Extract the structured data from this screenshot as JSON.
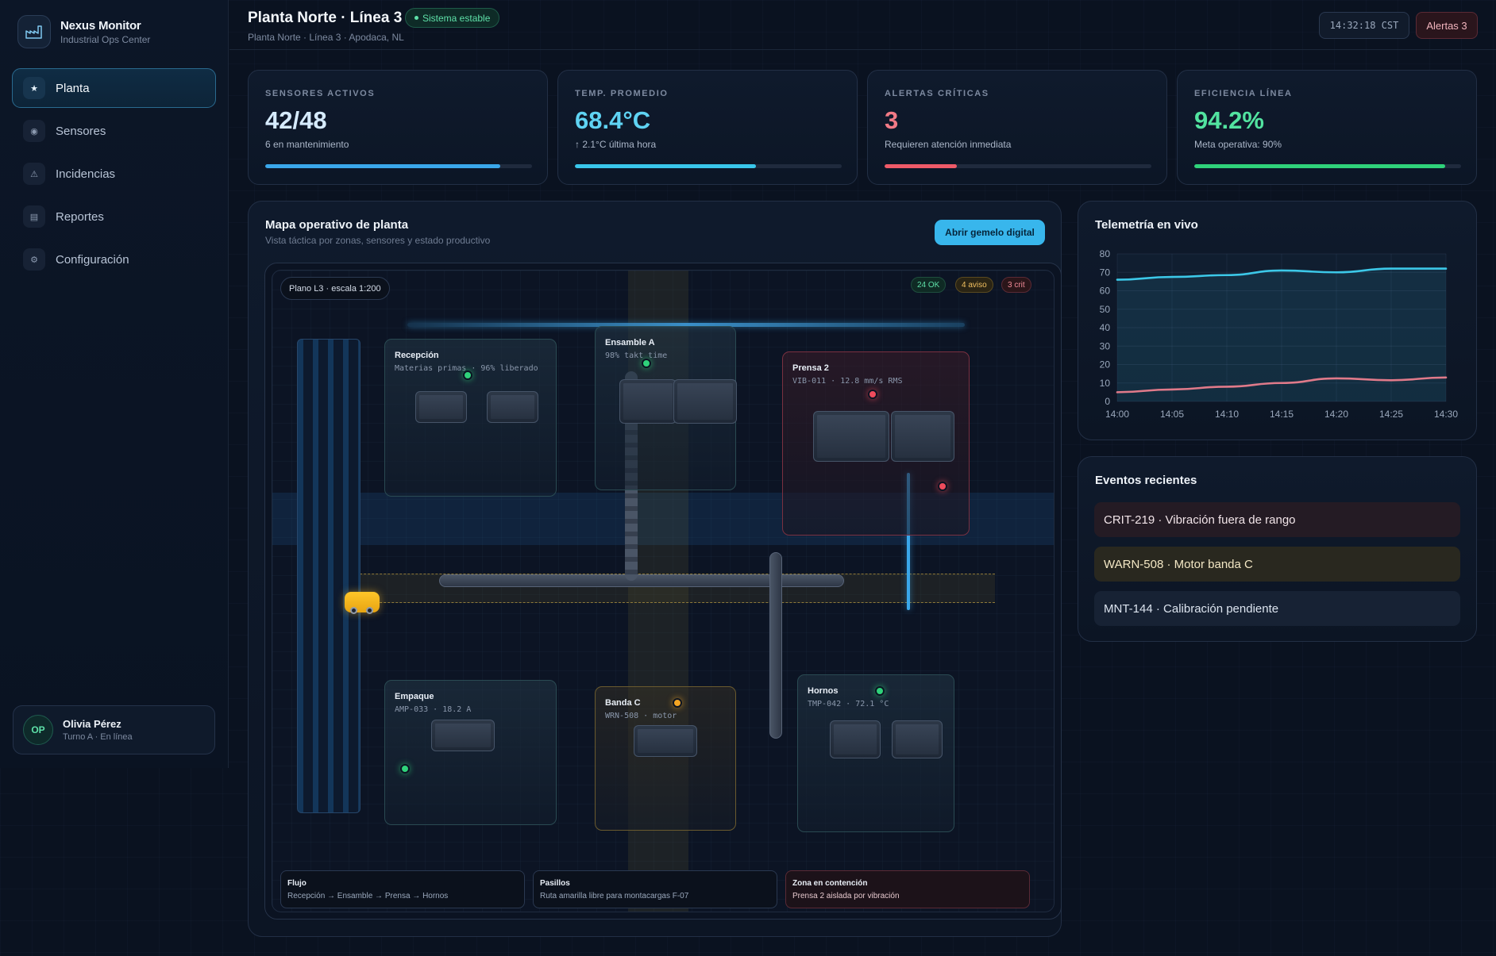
{
  "brand": {
    "name": "Nexus Monitor",
    "subtitle": "Industrial Ops Center"
  },
  "nav": [
    {
      "label": "Planta",
      "icon": "star-icon",
      "glyph": "★",
      "active": true
    },
    {
      "label": "Sensores",
      "icon": "sensor-icon",
      "glyph": "◉",
      "active": false
    },
    {
      "label": "Incidencias",
      "icon": "warning-icon",
      "glyph": "⚠",
      "active": false
    },
    {
      "label": "Reportes",
      "icon": "report-icon",
      "glyph": "▤",
      "active": false
    },
    {
      "label": "Configuración",
      "icon": "gear-icon",
      "glyph": "⚙",
      "active": false
    }
  ],
  "user": {
    "initials": "OP",
    "name": "Olivia Pérez",
    "status": "Turno A · En línea"
  },
  "header": {
    "title": "Planta Norte · Línea 3",
    "status": "Sistema estable",
    "breadcrumb": "Planta Norte · Línea 3 · Apodaca, NL",
    "clock": "14:32:18 CST",
    "alerts_label": "Alertas 3"
  },
  "kpis": [
    {
      "label": "SENSORES ACTIVOS",
      "value": "42/48",
      "sub": "6 en mantenimiento",
      "progress": 0.88,
      "color": "#3aa7ea",
      "value_color": "#d6ebff"
    },
    {
      "label": "TEMP. PROMEDIO",
      "value": "68.4°C",
      "sub": "↑ 2.1°C última hora",
      "progress": 0.68,
      "color": "#39c6ea",
      "value_color": "#5fd3f3"
    },
    {
      "label": "ALERTAS CRÍTICAS",
      "value": "3",
      "sub": "Requieren atención inmediata",
      "progress": 0.27,
      "color": "#ee5a68",
      "value_color": "#f27a86"
    },
    {
      "label": "EFICIENCIA LÍNEA",
      "value": "94.2%",
      "sub": "Meta operativa: 90%",
      "progress": 0.94,
      "color": "#2fd27a",
      "value_color": "#52e3a0"
    }
  ],
  "map": {
    "title": "Mapa operativo de planta",
    "subtitle": "Vista táctica por zonas, sensores y estado productivo",
    "button": "Abrir gemelo digital",
    "scale": "Plano L3 · escala 1:200",
    "counts": {
      "ok": "24 OK",
      "warn": "4 aviso",
      "crit": "3 crit"
    },
    "zones": {
      "recepcion": {
        "name": "Recepción",
        "meta": "Materias primas · 96% liberado"
      },
      "ensamble": {
        "name": "Ensamble A",
        "meta": "98% takt time"
      },
      "prensa": {
        "name": "Prensa 2",
        "meta": "VIB-011 · 12.8 mm/s RMS"
      },
      "empaque": {
        "name": "Empaque",
        "meta": "AMP-033 · 18.2 A"
      },
      "banda": {
        "name": "Banda C",
        "meta": "WRN-508 · motor"
      },
      "hornos": {
        "name": "Hornos",
        "meta": "TMP-042 · 72.1 °C"
      }
    },
    "legend": [
      {
        "title": "Flujo",
        "text": "Recepción → Ensamble → Prensa → Hornos"
      },
      {
        "title": "Pasillos",
        "text": "Ruta amarilla libre para montacargas F-07"
      },
      {
        "title": "Zona en contención",
        "text": "Prensa 2 aislada por vibración"
      }
    ]
  },
  "telemetry": {
    "title": "Telemetría en vivo"
  },
  "chart_data": {
    "type": "line",
    "title": "Telemetría en vivo",
    "x": [
      "14:00",
      "14:05",
      "14:10",
      "14:15",
      "14:20",
      "14:25",
      "14:30"
    ],
    "ylim": [
      0,
      80
    ],
    "yticks": [
      0,
      10,
      20,
      30,
      40,
      50,
      60,
      70,
      80
    ],
    "grid": true,
    "series": [
      {
        "color": "#3cc8e8",
        "values": [
          66,
          67.5,
          68.5,
          71,
          70,
          72,
          72
        ]
      },
      {
        "color": "#e07a8a",
        "values": [
          5,
          6.5,
          8,
          10,
          12.5,
          11.5,
          13
        ]
      }
    ]
  },
  "events": {
    "title": "Eventos recientes",
    "items": [
      {
        "text": "CRIT-219 · Vibración fuera de rango",
        "level": "crit"
      },
      {
        "text": "WARN-508 · Motor banda C",
        "level": "warn"
      },
      {
        "text": "MNT-144 · Calibración pendiente",
        "level": "info"
      }
    ]
  }
}
